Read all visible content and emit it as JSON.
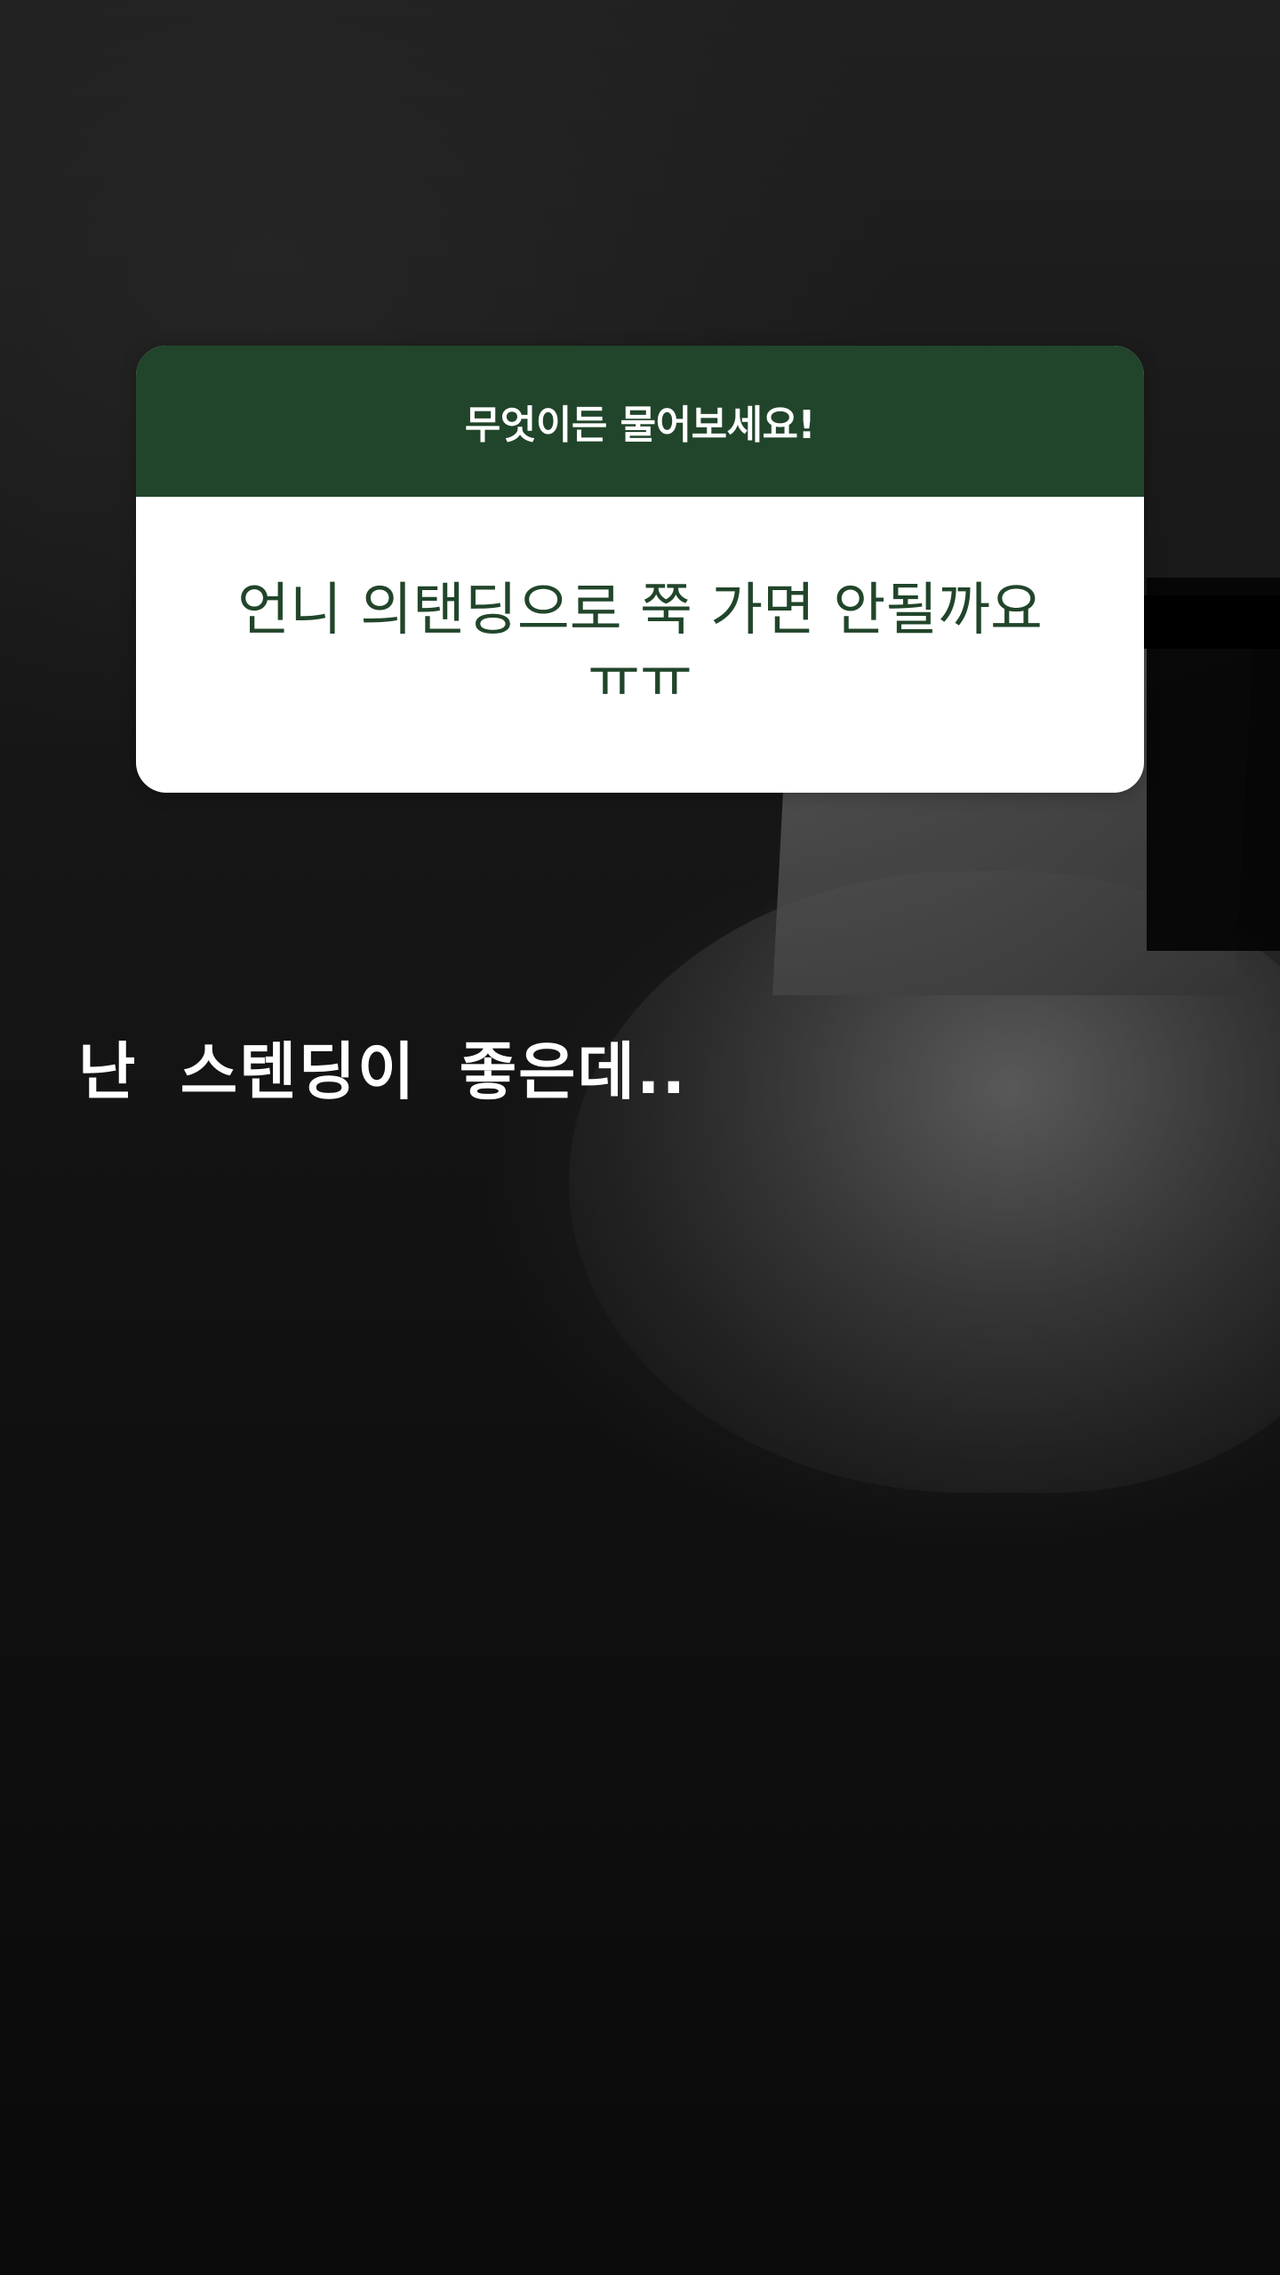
{
  "story": {
    "question_sticker": {
      "prompt": "무엇이든 물어보세요!",
      "question": "언니 의탠딩으로 쭉 가면 안될까요ㅠㅠ",
      "header_color": "#21452a",
      "text_color": "#21452a"
    },
    "reply": {
      "text": "난 스텐딩이 좋은데.."
    }
  }
}
